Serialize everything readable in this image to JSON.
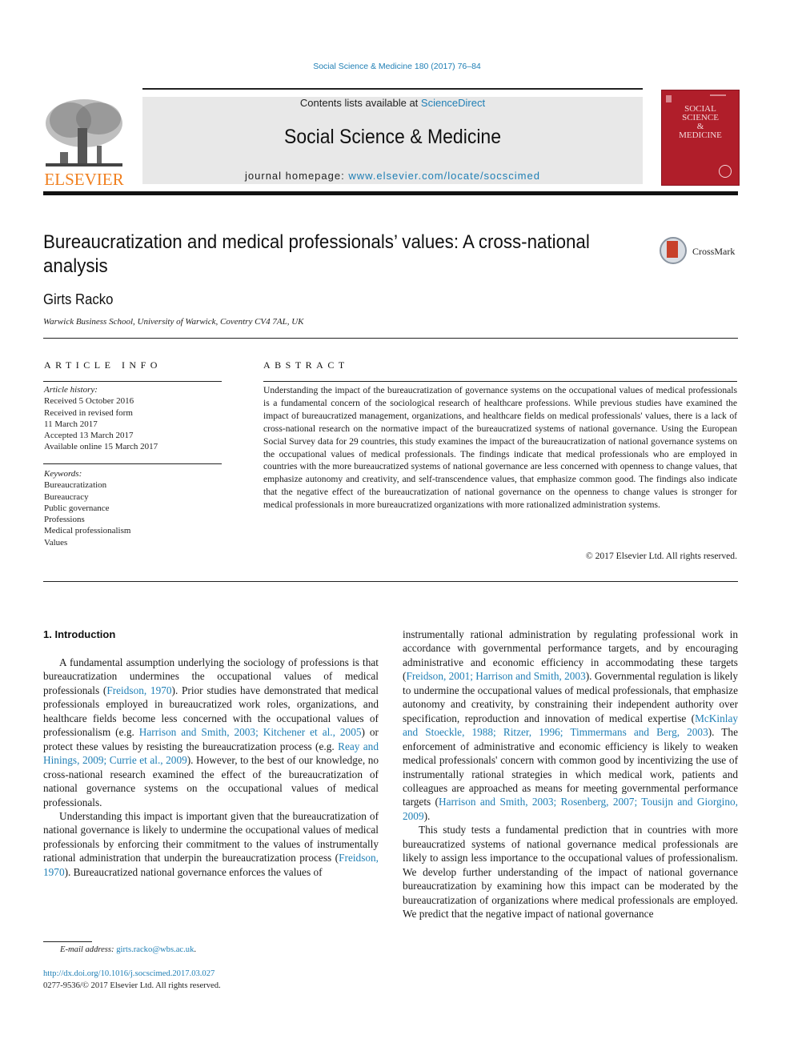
{
  "header": {
    "citation": "Social Science & Medicine 180 (2017) 76–84",
    "publisher_logo_text": "ELSEVIER",
    "contents_prefix": "Contents lists available at ",
    "contents_link": "ScienceDirect",
    "journal_title": "Social Science & Medicine",
    "homepage_prefix": "journal homepage: ",
    "homepage_link": "www.elsevier.com/locate/socscimed",
    "cover_title_lines": [
      "SOCIAL",
      "SCIENCE",
      "&",
      "MEDICINE"
    ],
    "crossmark_label": "CrossMark"
  },
  "colors": {
    "link": "#1f7fb5",
    "elsevier_orange": "#f07f1e",
    "cover_red": "#b01e2a",
    "masthead_gray": "#e8e8e8"
  },
  "article": {
    "title": "Bureaucratization and medical professionals’ values: A cross-national analysis",
    "author": "Girts Racko",
    "affiliation": "Warwick Business School, University of Warwick, Coventry CV4 7AL, UK"
  },
  "article_info": {
    "heading": "ARTICLE INFO",
    "history_label": "Article history:",
    "history": [
      "Received 5 October 2016",
      "Received in revised form",
      "11 March 2017",
      "Accepted 13 March 2017",
      "Available online 15 March 2017"
    ],
    "keywords_label": "Keywords:",
    "keywords": [
      "Bureaucratization",
      "Bureaucracy",
      "Public governance",
      "Professions",
      "Medical professionalism",
      "Values"
    ]
  },
  "abstract": {
    "heading": "ABSTRACT",
    "text": "Understanding the impact of the bureaucratization of governance systems on the occupational values of medical professionals is a fundamental concern of the sociological research of healthcare professions. While previous studies have examined the impact of bureaucratized management, organizations, and healthcare fields on medical professionals' values, there is a lack of cross-national research on the normative impact of the bureaucratized systems of national governance. Using the European Social Survey data for 29 countries, this study examines the impact of the bureaucratization of national governance systems on the occupational values of medical professionals. The findings indicate that medical professionals who are employed in countries with the more bureaucratized systems of national governance are less concerned with openness to change values, that emphasize autonomy and creativity, and self-transcendence values, that emphasize common good. The findings also indicate that the negative effect of the bureaucratization of national governance on the openness to change values is stronger for medical professionals in more bureaucratized organizations with more rationalized administration systems.",
    "copyright": "© 2017 Elsevier Ltd. All rights reserved."
  },
  "body": {
    "section_heading": "1.  Introduction",
    "left_p1": [
      {
        "t": "A fundamental assumption underlying the sociology of professions is that bureaucratization undermines the occupational values of medical professionals ("
      },
      {
        "t": "Freidson, 1970",
        "link": true
      },
      {
        "t": "). Prior studies have demonstrated that medical professionals employed in bureaucratized work roles, organizations, and healthcare fields become less concerned with the occupational values of professionalism (e.g. "
      },
      {
        "t": "Harrison and Smith, 2003; Kitchener et al., 2005",
        "link": true
      },
      {
        "t": ") or protect these values by resisting the bureaucratization process (e.g. "
      },
      {
        "t": "Reay and Hinings, 2009; Currie et al., 2009",
        "link": true
      },
      {
        "t": "). However, to the best of our knowledge, no cross-national research examined the effect of the bureaucratization of national governance systems on the occupational values of medical professionals."
      }
    ],
    "left_p2": [
      {
        "t": "Understanding this impact is important given that the bureaucratization of national governance is likely to undermine the occupational values of medical professionals by enforcing their commitment to the values of instrumentally rational administration that underpin the bureaucratization process ("
      },
      {
        "t": "Freidson, 1970",
        "link": true
      },
      {
        "t": "). Bureaucratized national governance enforces the values of"
      }
    ],
    "right_p1": [
      {
        "t": "instrumentally rational administration by regulating professional work in accordance with governmental performance targets, and by encouraging administrative and economic efficiency in accommodating these targets ("
      },
      {
        "t": "Freidson, 2001; Harrison and Smith, 2003",
        "link": true
      },
      {
        "t": "). Governmental regulation is likely to undermine the occupational values of medical professionals, that emphasize autonomy and creativity, by constraining their independent authority over specification, reproduction and innovation of medical expertise ("
      },
      {
        "t": "McKinlay and Stoeckle, 1988; Ritzer, 1996; Timmermans and Berg, 2003",
        "link": true
      },
      {
        "t": "). The enforcement of administrative and economic efficiency is likely to weaken medical professionals' concern with common good by incentivizing the use of instrumentally rational strategies in which medical work, patients and colleagues are approached as means for meeting governmental performance targets ("
      },
      {
        "t": "Harrison and Smith, 2003; Rosenberg, 2007; Tousijn and Giorgino, 2009",
        "link": true
      },
      {
        "t": ")."
      }
    ],
    "right_p2": [
      {
        "t": "This study tests a fundamental prediction that in countries with more bureaucratized systems of national governance medical professionals are likely to assign less importance to the occupational values of professionalism. We develop further understanding of the impact of national governance bureaucratization by examining how this impact can be moderated by the bureaucratization of organizations where medical professionals are employed. We predict that the negative impact of national governance"
      }
    ]
  },
  "footer": {
    "email_label": "E-mail address: ",
    "email": "girts.racko@wbs.ac.uk",
    "email_suffix": ".",
    "doi": "http://dx.doi.org/10.1016/j.socscimed.2017.03.027",
    "issn_line": "0277-9536/© 2017 Elsevier Ltd. All rights reserved."
  }
}
